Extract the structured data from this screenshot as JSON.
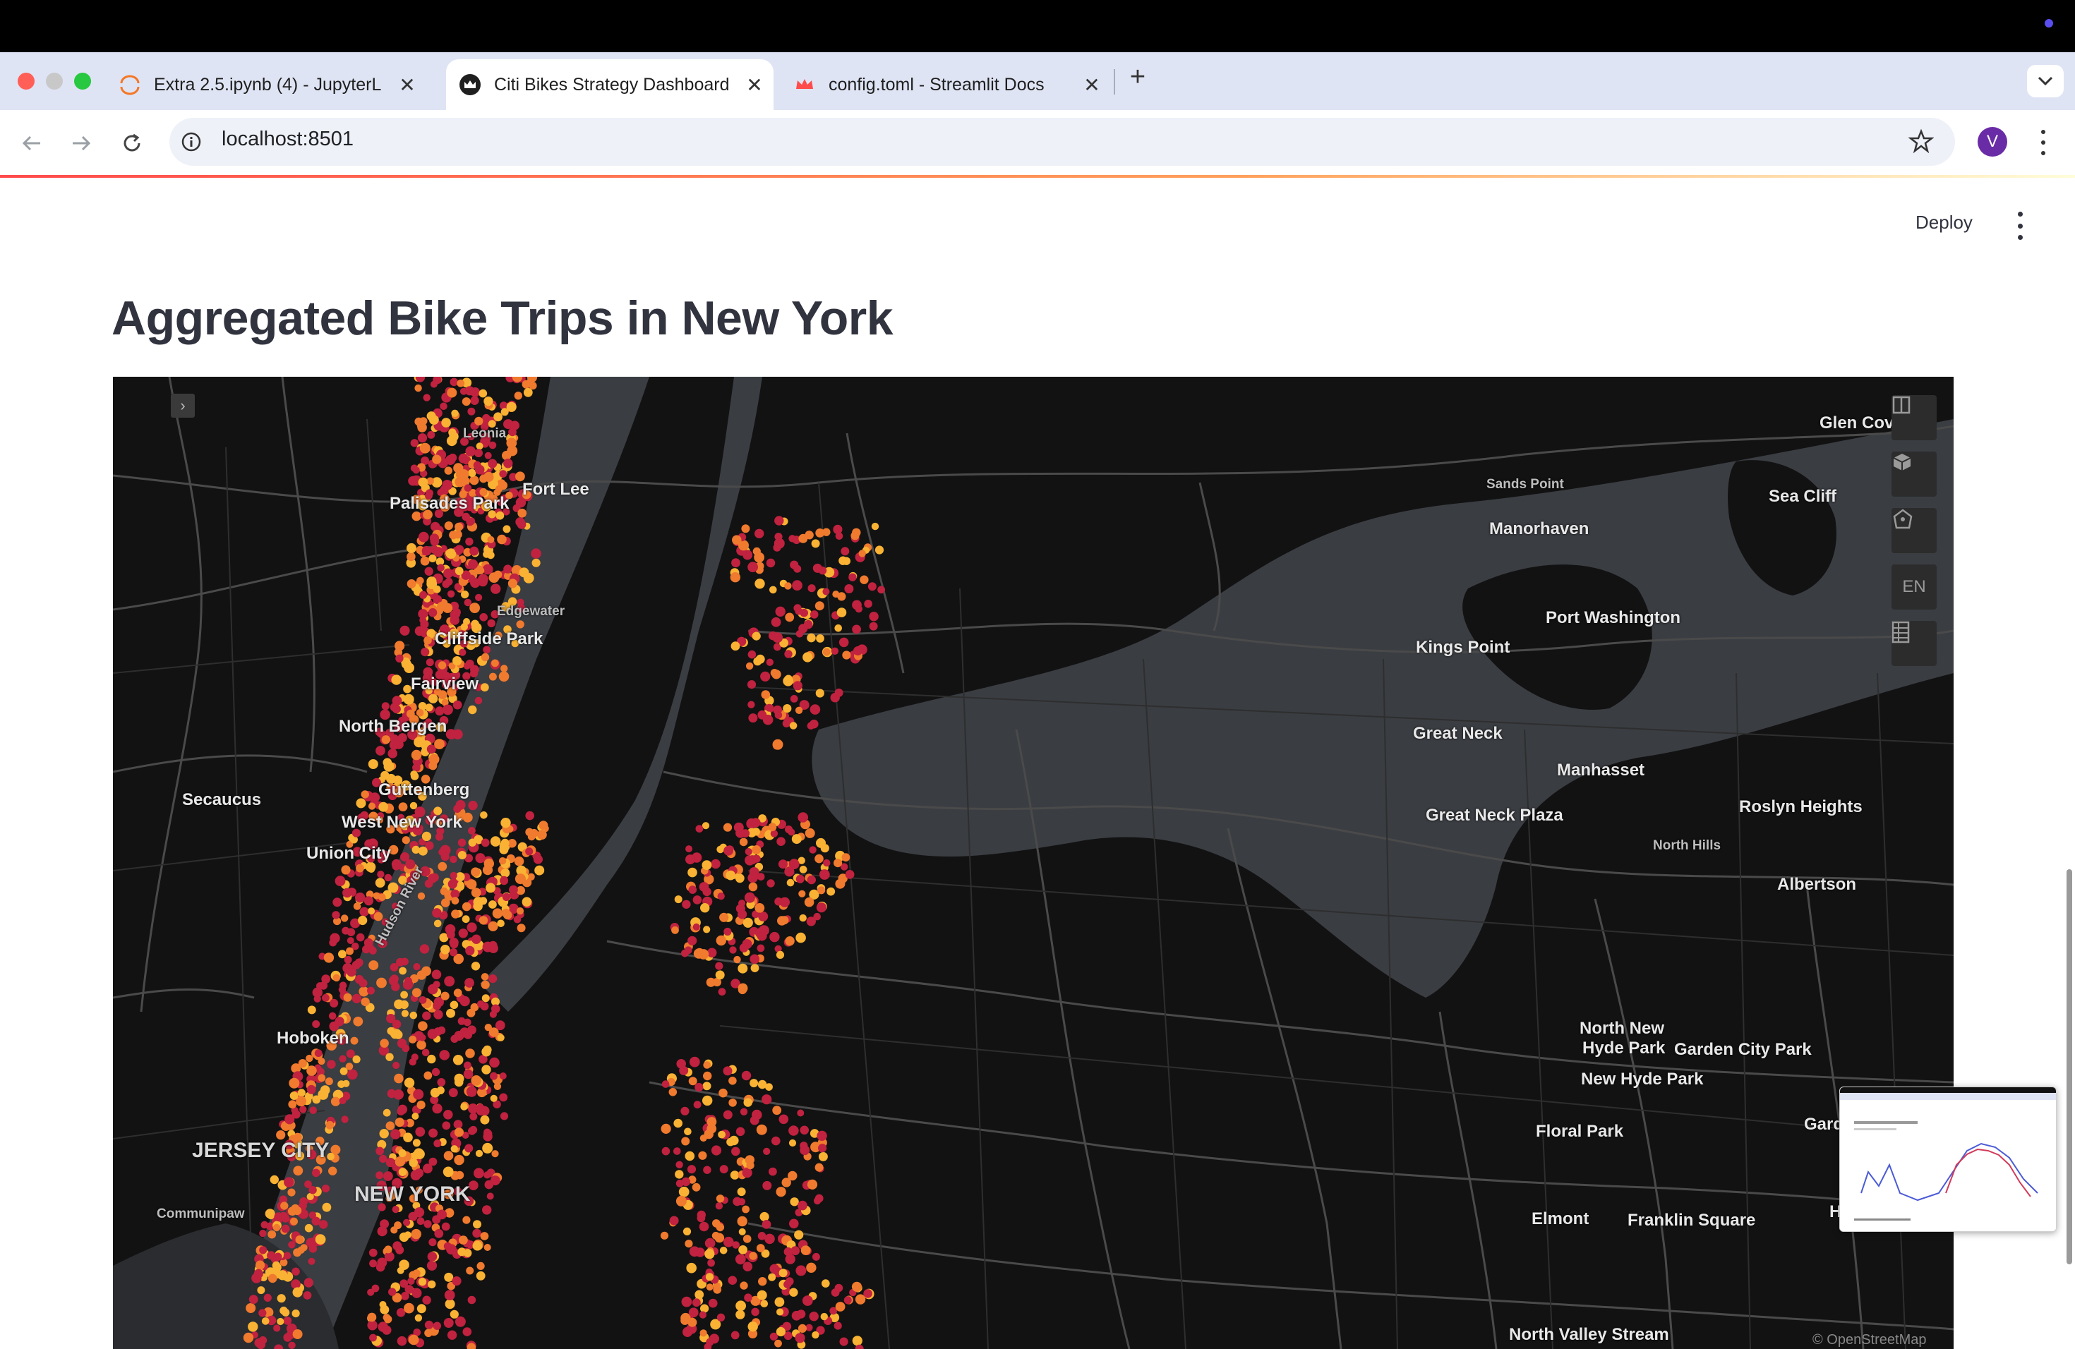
{
  "browser": {
    "tabs": [
      {
        "title": "Extra 2.5.ipynb (4) - JupyterL",
        "icon": "jupyter-icon"
      },
      {
        "title": "Citi Bikes Strategy Dashboard",
        "icon": "streamlit-crown-icon"
      },
      {
        "title": "config.toml - Streamlit Docs",
        "icon": "streamlit-crown-icon"
      }
    ],
    "new_tab_symbol": "+",
    "close_symbol": "✕",
    "url": "localhost:8501",
    "profile_initial": "V"
  },
  "app": {
    "deploy_label": "Deploy",
    "title": "Aggregated Bike Trips in New York"
  },
  "map": {
    "places": {
      "leonia": "Leonia",
      "fort_lee": "Fort Lee",
      "palisades_park": "Palisades Park",
      "edgewater": "Edgewater",
      "cliffside_park": "Cliffside Park",
      "fairview": "Fairview",
      "north_bergen": "North Bergen",
      "secaucus": "Secaucus",
      "guttenberg": "Guttenberg",
      "west_new_york": "West New York",
      "union_city": "Union City",
      "hudson_river": "Hudson River",
      "hoboken": "Hoboken",
      "jersey_city": "JERSEY CITY",
      "communipaw": "Communipaw",
      "new_york": "NEW YORK",
      "glen_cove": "Glen Cov",
      "sands_point": "Sands Point",
      "sea_cliff": "Sea Cliff",
      "manorhaven": "Manorhaven",
      "port_washington": "Port Washington",
      "kings_point": "Kings Point",
      "great_neck": "Great Neck",
      "manhasset": "Manhasset",
      "roslyn_heights": "Roslyn Heights",
      "great_neck_plaza": "Great Neck Plaza",
      "north_hills": "North Hills",
      "albertson": "Albertson",
      "north_new_hyde_park_1": "North New",
      "north_new_hyde_park_2": "Hyde Park",
      "garden_city_park": "Garden City Park",
      "new_hyde_park": "New Hyde Park",
      "gard": "Gard",
      "floral_park": "Floral Park",
      "elmont": "Elmont",
      "franklin_square": "Franklin Square",
      "h": "H",
      "north_valley_stream": "North Valley Stream"
    },
    "language_control": "EN",
    "attribution": "© OpenStreetMap",
    "colors": {
      "water": "#3a3d42",
      "land": "#121212",
      "dot_red": "#c0223f",
      "dot_orange": "#f07a2e",
      "dot_yellow": "#f9b233"
    }
  }
}
